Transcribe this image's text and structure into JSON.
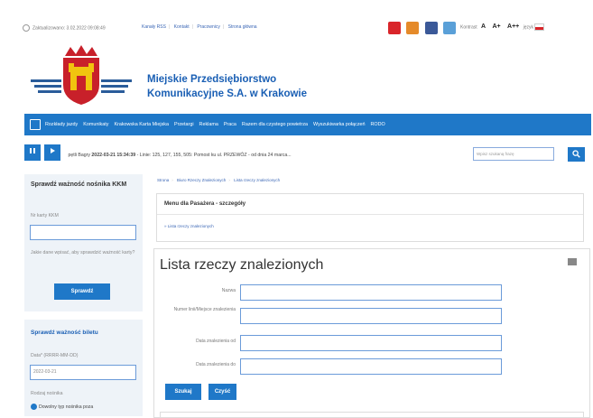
{
  "topbar": {
    "updated": "Zaktualizowano: 3.02.2022 09:08:49",
    "links": [
      "Kanały RSS",
      "Kontakt",
      "Pracownicy",
      "Strona główna"
    ],
    "contrast": "Kontrast",
    "font_sizes": [
      "A",
      "A+",
      "A++"
    ],
    "lang": "język"
  },
  "org": {
    "name_line1": "Miejskie Przedsiębiorstwo",
    "name_line2": "Komunikacyjne S.A. w Krakowie"
  },
  "nav": {
    "items": [
      "Rozkłady jazdy",
      "Komunikaty",
      "Krakowska Karta Miejska",
      "Przetargi",
      "Reklama",
      "Praca",
      "Razem dla czystego powietrza",
      "Wyszukiwarka połączeń",
      "RODO"
    ]
  },
  "ticker": {
    "stop_label": "pętli Bagry",
    "datetime": "2022-03-21 15:34:39",
    "text": "- Linie: 125, 127, 155, 505: Pomost ku ul. PRZEWÓZ - od dnia 24 marca..."
  },
  "search": {
    "placeholder": "Wpisz szukaną frazę"
  },
  "kkm_card": {
    "title": "Sprawdź ważność nośnika KKM",
    "field_label": "Nr karty KKM",
    "help": "Jakie dane wpisać, aby sprawdzić ważność karty?",
    "button": "Sprawdź"
  },
  "ticket_card": {
    "title": "Sprawdź ważność biletu",
    "date_label": "Data* (RRRR-MM-DD)",
    "date_value": "2022-03-21",
    "carrier_label": "Rodzaj nośnika",
    "radio_label": "Dowolny typ nośnika poza"
  },
  "breadcrumb": [
    "Strona",
    "Biuro Rzeczy Znalezionych",
    "Lista rzeczy znalezionych"
  ],
  "menu_box": {
    "title": "Menu dla Pasażera - szczegóły",
    "link": "» Lista rzeczy znalezionych"
  },
  "main": {
    "title": "Lista rzeczy znalezionych",
    "fields": [
      "Nazwa",
      "Numer linii/Miejsce znalezienia",
      "Data znalezienia od",
      "Data znalezienia do"
    ],
    "search_button": "Szukaj",
    "clear_button": "Czyść"
  },
  "colors": {
    "accent": "#1f78c8",
    "logo_red": "#c8202a"
  }
}
